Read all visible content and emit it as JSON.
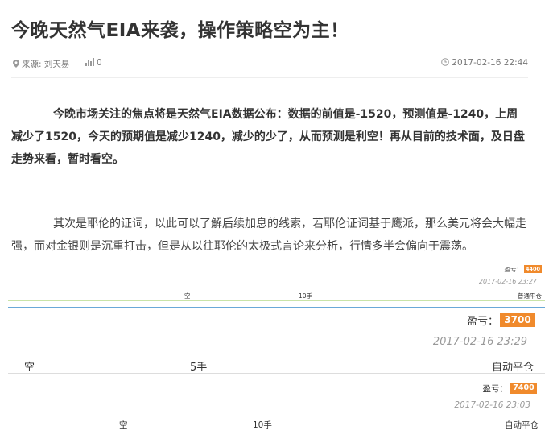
{
  "article": {
    "title": "今晚天然气EIA来袭，操作策略空为主！",
    "source": "来源: 刘天易",
    "views": "0",
    "date": "2017-02-16 22:44",
    "paragraph1": "今晚市场关注的焦点将是天然气EIA数据公布：数据的前值是-1520，预测值是-1240，上周减少了1520，今天的预期值是减少1240，减少的少了，从而预测是利空！再从目前的技术面，及日盘走势来看，暂时看空。",
    "paragraph2": "其次是耶伦的证词，以此可以了解后续加息的线索，若耶伦证词基于鹰派，那么美元将会大幅走强，而对金银则是沉重打击，但是从以往耶伦的太极式言论来分析，行情多半会偏向于震荡。"
  },
  "records": [
    {
      "profit_label": "盈亏：",
      "profit": "4400",
      "time": "2017-02-16 23:27",
      "direction": "空",
      "quantity": "10手",
      "type": "普通平仓"
    },
    {
      "profit_label": "盈亏：",
      "profit": "3700",
      "time": "2017-02-16 23:29",
      "direction": "空",
      "quantity": "5手",
      "type": "自动平仓"
    },
    {
      "profit_label": "盈亏：",
      "profit": "7400",
      "time": "2017-02-16 23:03",
      "direction": "空",
      "quantity": "10手",
      "type": "自动平仓"
    }
  ],
  "icons": {
    "source": "location-pin-icon",
    "views": "bar-chart-icon",
    "date": "clock-icon"
  },
  "colors": {
    "badge": "#f08a2c",
    "divider_blue": "#6aa8d8",
    "divider_green": "#c9e3a8"
  }
}
